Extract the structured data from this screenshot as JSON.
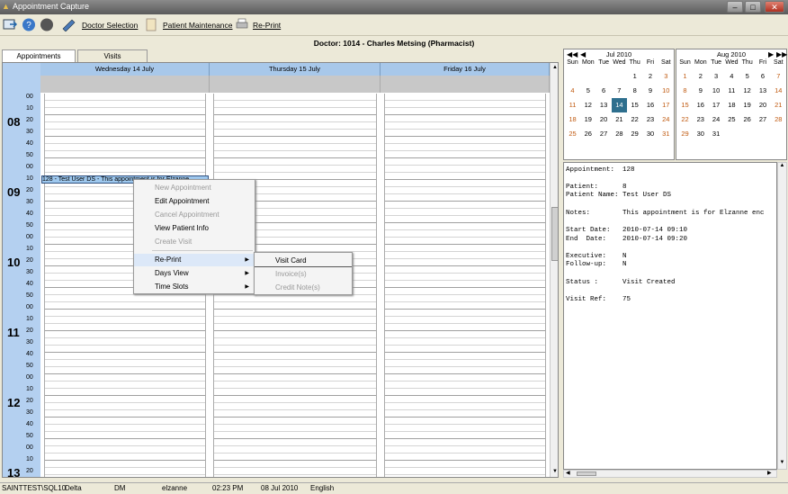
{
  "window": {
    "title": "Appointment Capture",
    "minimize": "–",
    "maximize": "□",
    "close": "✕"
  },
  "toolbar": {
    "doctor_selection": "Doctor Selection",
    "patient_maintenance": "Patient Maintenance",
    "reprint": "Re-Print"
  },
  "doctor_header": "Doctor: 1014 - Charles Metsing (Pharmacist)",
  "tabs": [
    "Appointments",
    "Visits"
  ],
  "days": [
    "Wednesday 14 July",
    "Thursday 15 July",
    "Friday 16 July"
  ],
  "hours": [
    "08",
    "09",
    "10",
    "11",
    "12",
    "13"
  ],
  "minutes": [
    "00",
    "10",
    "20",
    "30",
    "40",
    "50"
  ],
  "appointment_text": "128 - Test User DS - This appointment is for Elzanne",
  "context_menu": {
    "items": [
      {
        "label": "New Appointment",
        "enabled": false
      },
      {
        "label": "Edit Appointment",
        "enabled": true
      },
      {
        "label": "Cancel Appointment",
        "enabled": false
      },
      {
        "label": "View Patient Info",
        "enabled": true
      },
      {
        "label": "Create Visit",
        "enabled": false
      },
      {
        "label": "Re-Print",
        "enabled": true,
        "submenu": true
      },
      {
        "label": "Days View",
        "enabled": true,
        "submenu": true
      },
      {
        "label": "Time Slots",
        "enabled": true,
        "submenu": true
      }
    ],
    "submenu": [
      {
        "label": "Visit Card",
        "enabled": true
      },
      {
        "label": "Invoice(s)",
        "enabled": false
      },
      {
        "label": "Credit Note(s)",
        "enabled": false
      }
    ]
  },
  "mini_calendars": [
    {
      "month": "Jul 2010",
      "dow": [
        "Sun",
        "Mon",
        "Tue",
        "Wed",
        "Thu",
        "Fri",
        "Sat"
      ],
      "days": [
        "",
        "",
        "",
        "",
        "1",
        "2",
        "3",
        "4",
        "5",
        "6",
        "7",
        "8",
        "9",
        "10",
        "11",
        "12",
        "13",
        "14",
        "15",
        "16",
        "17",
        "18",
        "19",
        "20",
        "21",
        "22",
        "23",
        "24",
        "25",
        "26",
        "27",
        "28",
        "29",
        "30",
        "31"
      ],
      "selected": "14"
    },
    {
      "month": "Aug 2010",
      "dow": [
        "Sun",
        "Mon",
        "Tue",
        "Wed",
        "Thu",
        "Fri",
        "Sat"
      ],
      "days": [
        "1",
        "2",
        "3",
        "4",
        "5",
        "6",
        "7",
        "8",
        "9",
        "10",
        "11",
        "12",
        "13",
        "14",
        "15",
        "16",
        "17",
        "18",
        "19",
        "20",
        "21",
        "22",
        "23",
        "24",
        "25",
        "26",
        "27",
        "28",
        "29",
        "30",
        "31"
      ],
      "selected": ""
    }
  ],
  "details": {
    "appointment": "Appointment:  128",
    "patient": "Patient:      8",
    "patient_name": "Patient Name: Test User DS",
    "notes": "Notes:        This appointment is for Elzanne enc",
    "start_date": "Start Date:   2010-07-14 09:10",
    "end_date": "End  Date:    2010-07-14 09:20",
    "executive": "Executive:    N",
    "follow_up": "Follow-up:    N",
    "status": "Status :      Visit Created",
    "visit_ref": "Visit Ref:    75"
  },
  "statusbar": {
    "server": "SAINTTEST\\SQL10",
    "db": "Delta",
    "code": "DM",
    "user": "elzanne",
    "time": "02:23 PM",
    "date": "08 Jul 2010",
    "language": "English"
  },
  "colors": {
    "accent": "#2e6f8e",
    "day_header": "#a8c8ea",
    "appointment": "#9ec8ee",
    "time_column": "#b4d0f0"
  }
}
